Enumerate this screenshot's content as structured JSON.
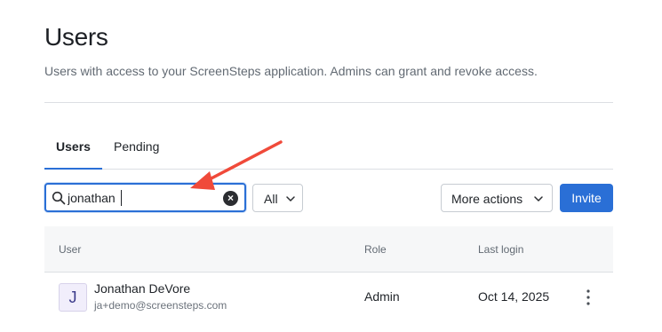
{
  "page": {
    "title": "Users",
    "description": "Users with access to your ScreenSteps application. Admins can grant and revoke access."
  },
  "tabs": [
    {
      "label": "Users",
      "active": true
    },
    {
      "label": "Pending",
      "active": false
    }
  ],
  "toolbar": {
    "search": {
      "value": "jonathan",
      "icon": "search-icon",
      "clear_icon": "close-circle-icon"
    },
    "filter": {
      "selected": "All",
      "icon": "chevron-down-icon"
    },
    "more_actions_label": "More actions",
    "invite_label": "Invite"
  },
  "table": {
    "columns": [
      "User",
      "Role",
      "Last login"
    ],
    "rows": [
      {
        "avatar_initial": "J",
        "name": "Jonathan DeVore",
        "email": "ja+demo@screensteps.com",
        "role": "Admin",
        "last_login": "Oct 14, 2025",
        "menu_icon": "kebab-menu-icon"
      }
    ]
  },
  "colors": {
    "accent": "#2a6fd6",
    "annotation_arrow": "#f04a3a"
  }
}
